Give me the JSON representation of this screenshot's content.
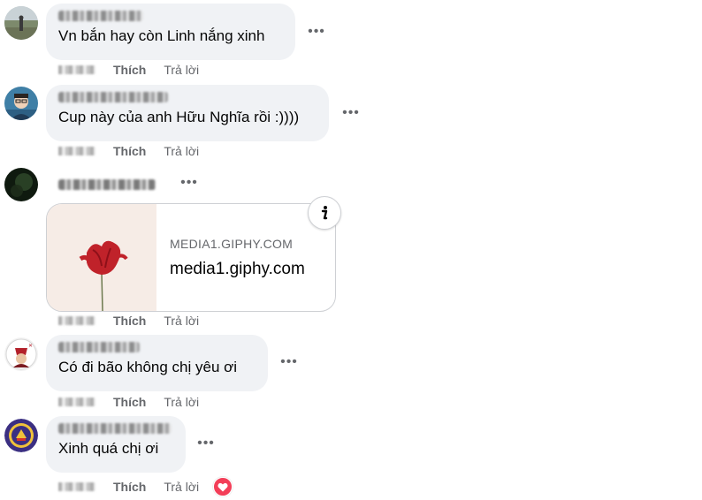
{
  "actions": {
    "like_label": "Thích",
    "reply_label": "Trả lời"
  },
  "more_icon": "•••",
  "comments": [
    {
      "text": "Vn bắn hay còn Linh nắng xinh"
    },
    {
      "text": "Cup này của anh Hữu Nghĩa rồi :))))"
    },
    {
      "link_card": {
        "domain": "MEDIA1.GIPHY.COM",
        "title": "media1.giphy.com"
      }
    },
    {
      "text": "Có đi bão không chị yêu ơi"
    },
    {
      "text": "Xinh quá chị ơi",
      "reaction": "heart"
    }
  ],
  "colors": {
    "bubble_bg": "#f0f2f5",
    "meta_text": "#65676b",
    "reaction_heart": "#f33e58"
  },
  "icons": {
    "more": "more-options-icon",
    "info": "info-icon",
    "reaction": "heart-reaction-icon"
  }
}
